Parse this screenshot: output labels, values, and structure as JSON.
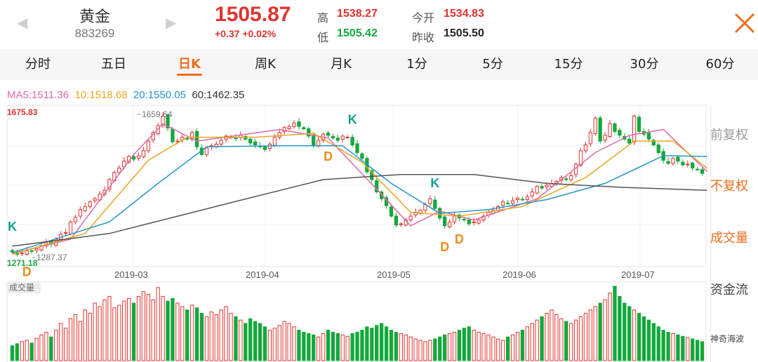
{
  "header": {
    "name": "黄金",
    "code": "883269",
    "price": "1505.87",
    "change": "+0.37",
    "change_pct": "+0.02%",
    "high_label": "高",
    "high": "1538.27",
    "open_label": "今开",
    "open": "1534.83",
    "low_label": "低",
    "low": "1505.42",
    "prev_close_label": "昨收",
    "prev_close": "1505.50",
    "close_icon": "close-x-icon",
    "prev_icon": "arrow-left-icon",
    "next_icon": "arrow-right-icon"
  },
  "tabs": [
    {
      "label": "分时"
    },
    {
      "label": "五日"
    },
    {
      "label": "日K",
      "active": true
    },
    {
      "label": "周K"
    },
    {
      "label": "月K"
    },
    {
      "label": "1分"
    },
    {
      "label": "5分"
    },
    {
      "label": "15分"
    },
    {
      "label": "30分"
    },
    {
      "label": "60分"
    }
  ],
  "ma_legend": {
    "ma5": "MA5:1511.36",
    "ma10": "10:1518.68",
    "ma20": "20:1550.05",
    "ma60": "60:1462.35"
  },
  "side_menu": [
    {
      "label": "前复权",
      "active": false
    },
    {
      "label": "不复权",
      "active": true
    },
    {
      "label": "成交量",
      "active": true
    },
    {
      "label": "资金流",
      "active": false
    },
    {
      "label": "神奇海波",
      "active": false
    }
  ],
  "volume_label": "成交量",
  "colors": {
    "up": "#e0332f",
    "down": "#14a83c",
    "ma5": "#e06aa8",
    "ma10": "#e8a623",
    "ma20": "#2596c6",
    "ma60": "#555555",
    "accent": "#ef6c1a",
    "signal_k": "#13a394",
    "signal_d": "#ef8b1a"
  },
  "chart_data": {
    "type": "candlestick",
    "y_max_label": "1675.83",
    "y_min_label": "1271.18",
    "ylim": [
      1271.18,
      1675.83
    ],
    "x_tick_labels": [
      "2019-03",
      "2019-03",
      "2019-04",
      "2019-05",
      "2019-06",
      "2019-07"
    ],
    "annotations": [
      {
        "text": "1659.64",
        "value": 1659.64
      },
      {
        "text": "1287.37",
        "value": 1287.37
      }
    ],
    "closes": [
      1302,
      1296,
      1299,
      1305,
      1303,
      1310,
      1318,
      1326,
      1322,
      1335,
      1348,
      1352,
      1380,
      1392,
      1412,
      1420,
      1432,
      1440,
      1452,
      1462,
      1490,
      1508,
      1520,
      1538,
      1550,
      1543,
      1552,
      1565,
      1590,
      1612,
      1630,
      1655,
      1624,
      1588,
      1590,
      1600,
      1595,
      1612,
      1575,
      1555,
      1572,
      1578,
      1582,
      1592,
      1603,
      1600,
      1596,
      1605,
      1595,
      1585,
      1580,
      1575,
      1568,
      1582,
      1600,
      1612,
      1625,
      1628,
      1637,
      1628,
      1622,
      1603,
      1580,
      1592,
      1608,
      1605,
      1598,
      1592,
      1603,
      1600,
      1580,
      1560,
      1545,
      1510,
      1490,
      1458,
      1440,
      1422,
      1395,
      1372,
      1375,
      1385,
      1395,
      1405,
      1410,
      1425,
      1440,
      1415,
      1390,
      1370,
      1380,
      1395,
      1390,
      1385,
      1375,
      1380,
      1385,
      1395,
      1405,
      1410,
      1420,
      1432,
      1428,
      1435,
      1442,
      1438,
      1445,
      1458,
      1472,
      1468,
      1475,
      1480,
      1485,
      1495,
      1490,
      1500,
      1530,
      1565,
      1580,
      1612,
      1650,
      1590,
      1605,
      1635,
      1615,
      1605,
      1595,
      1585,
      1655,
      1615,
      1608,
      1595,
      1580,
      1560,
      1540,
      1532,
      1545,
      1538,
      1528,
      1530,
      1520,
      1516,
      1506
    ],
    "ma_lines": {
      "ma5": [
        [
          0,
          1298
        ],
        [
          12,
          1335
        ],
        [
          25,
          1555
        ],
        [
          31,
          1635
        ],
        [
          38,
          1590
        ],
        [
          55,
          1620
        ],
        [
          65,
          1598
        ],
        [
          75,
          1465
        ],
        [
          82,
          1370
        ],
        [
          88,
          1408
        ],
        [
          95,
          1385
        ],
        [
          108,
          1440
        ],
        [
          120,
          1560
        ],
        [
          127,
          1605
        ],
        [
          134,
          1620
        ],
        [
          143,
          1511
        ]
      ],
      "ma10": [
        [
          0,
          1296
        ],
        [
          15,
          1350
        ],
        [
          28,
          1540
        ],
        [
          36,
          1600
        ],
        [
          50,
          1600
        ],
        [
          62,
          1610
        ],
        [
          72,
          1535
        ],
        [
          82,
          1405
        ],
        [
          92,
          1395
        ],
        [
          105,
          1420
        ],
        [
          118,
          1495
        ],
        [
          128,
          1590
        ],
        [
          136,
          1590
        ],
        [
          143,
          1519
        ]
      ],
      "ma20": [
        [
          0,
          1300
        ],
        [
          20,
          1380
        ],
        [
          30,
          1480
        ],
        [
          40,
          1575
        ],
        [
          55,
          1578
        ],
        [
          68,
          1578
        ],
        [
          78,
          1480
        ],
        [
          88,
          1402
        ],
        [
          98,
          1412
        ],
        [
          110,
          1438
        ],
        [
          122,
          1480
        ],
        [
          134,
          1552
        ],
        [
          143,
          1550
        ]
      ],
      "ma60": [
        [
          0,
          1317
        ],
        [
          20,
          1350
        ],
        [
          45,
          1430
        ],
        [
          64,
          1490
        ],
        [
          80,
          1503
        ],
        [
          95,
          1503
        ],
        [
          110,
          1480
        ],
        [
          125,
          1470
        ],
        [
          143,
          1462
        ]
      ]
    },
    "signals": [
      {
        "text": "D",
        "i": 3
      },
      {
        "text": "K",
        "i": 0
      },
      {
        "text": "K",
        "i": 31
      },
      {
        "text": "D",
        "i": 65
      },
      {
        "text": "K",
        "i": 70
      },
      {
        "text": "K",
        "i": 87
      },
      {
        "text": "D",
        "i": 89
      },
      {
        "text": "D",
        "i": 92
      },
      {
        "text": "K",
        "i": 128
      }
    ],
    "volume": {
      "label": "成交量",
      "values": [
        22,
        25,
        28,
        30,
        26,
        33,
        38,
        42,
        35,
        45,
        55,
        48,
        62,
        68,
        58,
        75,
        70,
        85,
        80,
        90,
        95,
        78,
        82,
        88,
        92,
        85,
        95,
        102,
        98,
        90,
        108,
        95,
        88,
        92,
        85,
        80,
        75,
        82,
        78,
        70,
        65,
        72,
        68,
        75,
        80,
        70,
        65,
        60,
        55,
        62,
        58,
        55,
        50,
        45,
        48,
        52,
        58,
        55,
        50,
        45,
        42,
        40,
        38,
        35,
        40,
        45,
        42,
        40,
        38,
        36,
        40,
        42,
        45,
        50,
        48,
        52,
        55,
        50,
        45,
        42,
        40,
        38,
        35,
        32,
        30,
        28,
        30,
        32,
        35,
        38,
        40,
        42,
        45,
        48,
        50,
        45,
        42,
        40,
        38,
        35,
        32,
        30,
        35,
        38,
        42,
        45,
        50,
        55,
        60,
        65,
        70,
        75,
        68,
        62,
        58,
        55,
        60,
        65,
        70,
        75,
        80,
        85,
        90,
        100,
        110,
        95,
        85,
        80,
        75,
        70,
        65,
        60,
        55,
        50,
        45,
        42,
        40,
        38,
        36,
        34,
        32,
        30,
        28
      ]
    }
  }
}
